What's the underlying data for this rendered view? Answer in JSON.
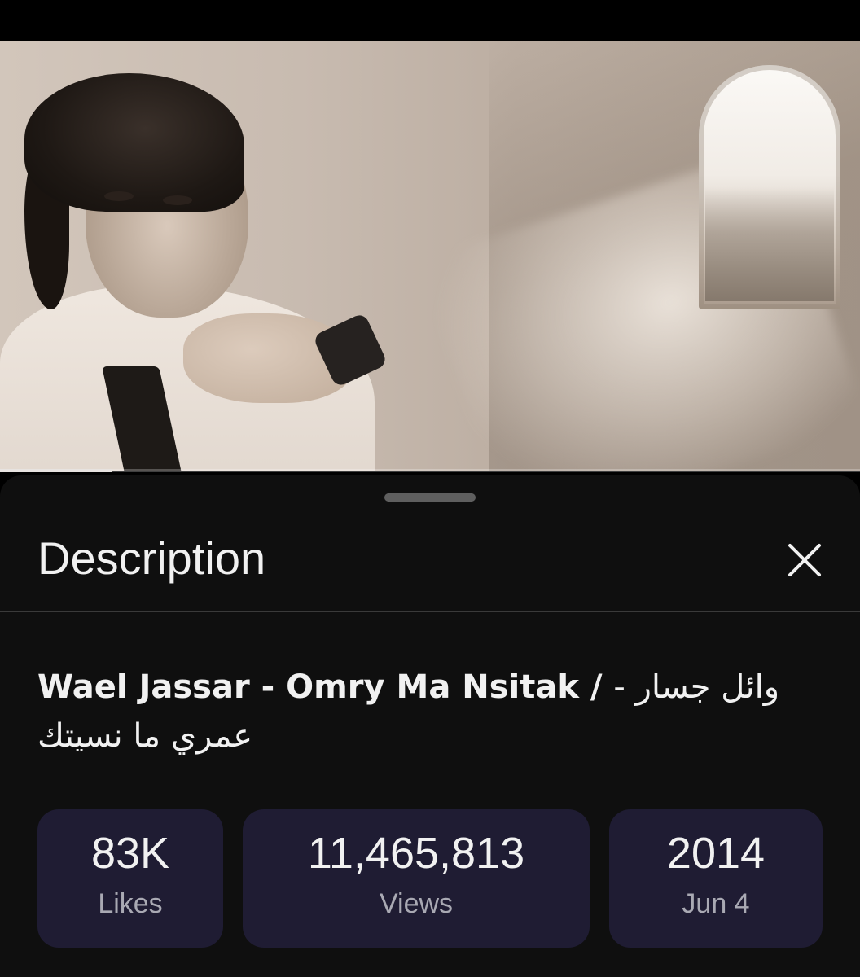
{
  "player": {
    "progress_fraction": 0.13
  },
  "sheet": {
    "title": "Description",
    "close_icon": "close-icon"
  },
  "video": {
    "title_latin": "Wael Jassar - Omry Ma Nsitak / ",
    "title_arabic": "وائل جسار - عمري ما نسيتك"
  },
  "stats": {
    "likes": {
      "value": "83K",
      "label": "Likes"
    },
    "views": {
      "value": "11,465,813",
      "label": "Views"
    },
    "date": {
      "value": "2014",
      "label": "Jun 4"
    }
  },
  "colors": {
    "sheet_background": "#0f0f0f",
    "stat_card_background": "#1f1c33",
    "text_primary": "#f1f1f1",
    "text_secondary": "#a9a9b3"
  }
}
